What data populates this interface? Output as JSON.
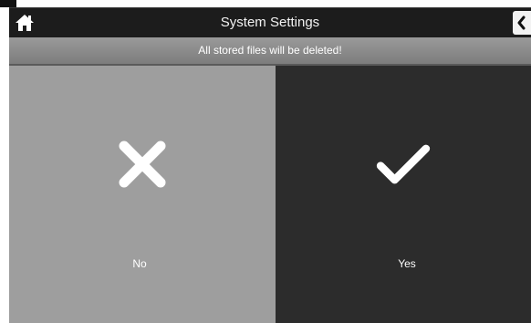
{
  "header": {
    "title": "System Settings",
    "home_icon": "home-icon",
    "back_icon": "back-chevron-icon"
  },
  "warning": {
    "text": "All stored files will be deleted!"
  },
  "options": {
    "no": {
      "label": "No",
      "icon": "close-x-icon",
      "color": "#9e9e9e"
    },
    "yes": {
      "label": "Yes",
      "icon": "checkmark-icon",
      "color": "#2c2c2c"
    }
  }
}
